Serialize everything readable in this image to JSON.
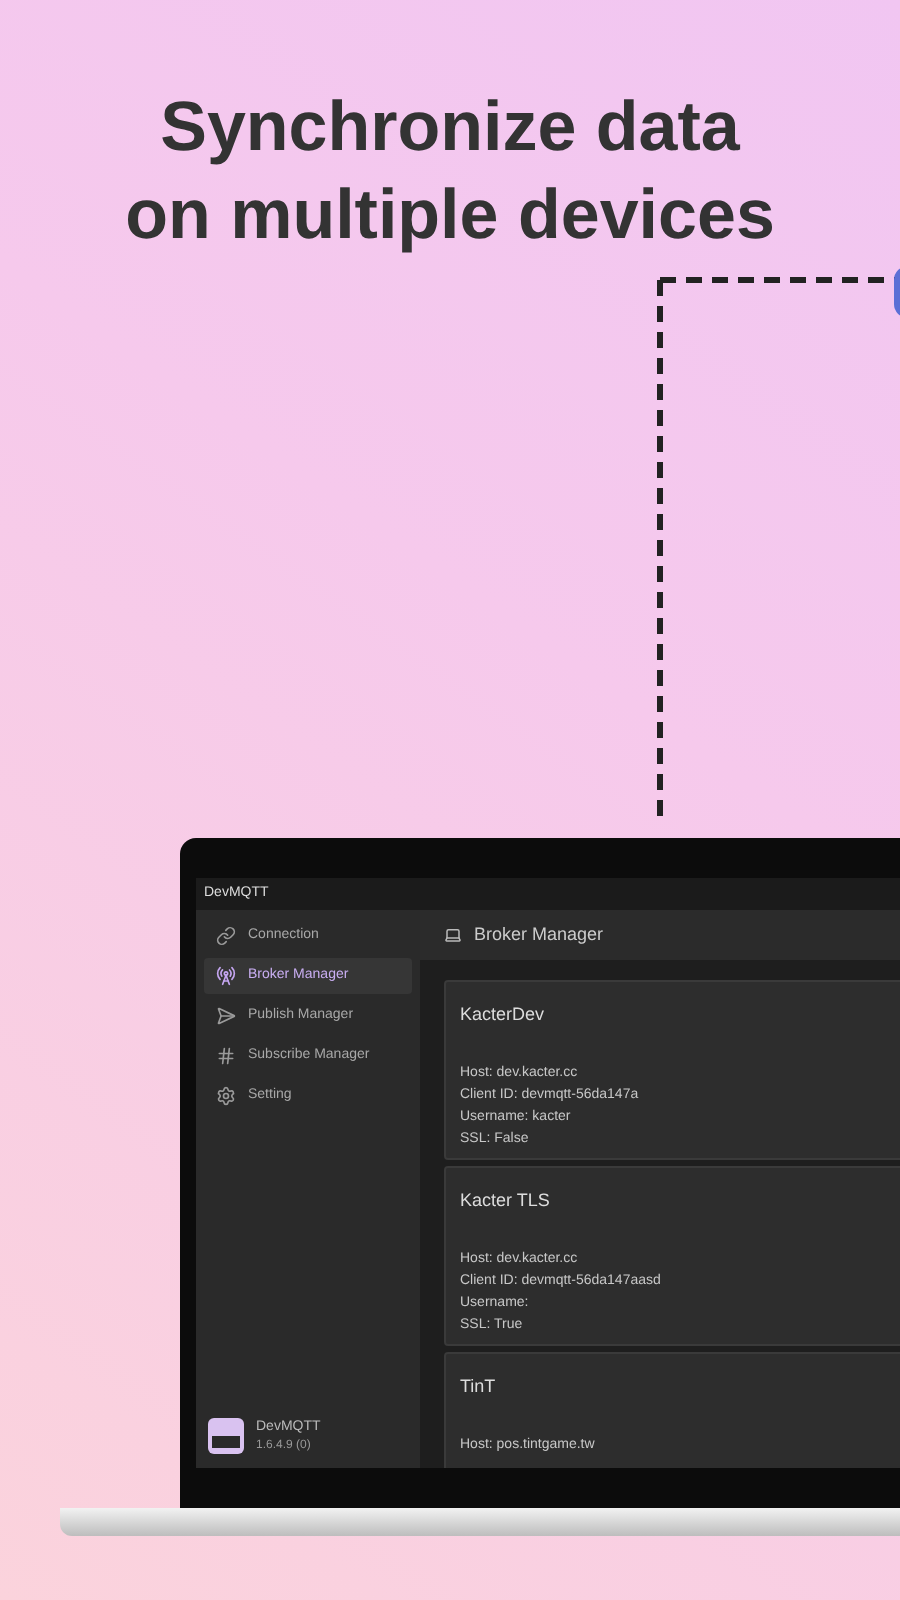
{
  "headline": [
    "Synchronize data",
    "on multiple devices"
  ],
  "app": {
    "title": "DevMQTT",
    "sidebar": {
      "items": [
        {
          "kind": "link",
          "label": "Connection",
          "selected": false
        },
        {
          "kind": "antenna",
          "label": "Broker Manager",
          "selected": true
        },
        {
          "kind": "send",
          "label": "Publish Manager",
          "selected": false
        },
        {
          "kind": "hash",
          "label": "Subscribe Manager",
          "selected": false
        },
        {
          "kind": "gear",
          "label": "Setting",
          "selected": false
        }
      ],
      "footer": {
        "name": "DevMQTT",
        "version": "1.6.4.9 (0)"
      }
    },
    "header": {
      "title": "Broker Manager"
    },
    "brokers": [
      {
        "name": "KacterDev",
        "lines": [
          "Host: dev.kacter.cc",
          "Client ID: devmqtt-56da147a",
          "Username: kacter",
          "SSL: False"
        ]
      },
      {
        "name": "Kacter TLS",
        "lines": [
          "Host: dev.kacter.cc",
          "Client ID: devmqtt-56da147aasd",
          "Username:",
          "SSL: True"
        ]
      },
      {
        "name": "TinT",
        "lines": [
          "Host: pos.tintgame.tw"
        ]
      }
    ]
  }
}
